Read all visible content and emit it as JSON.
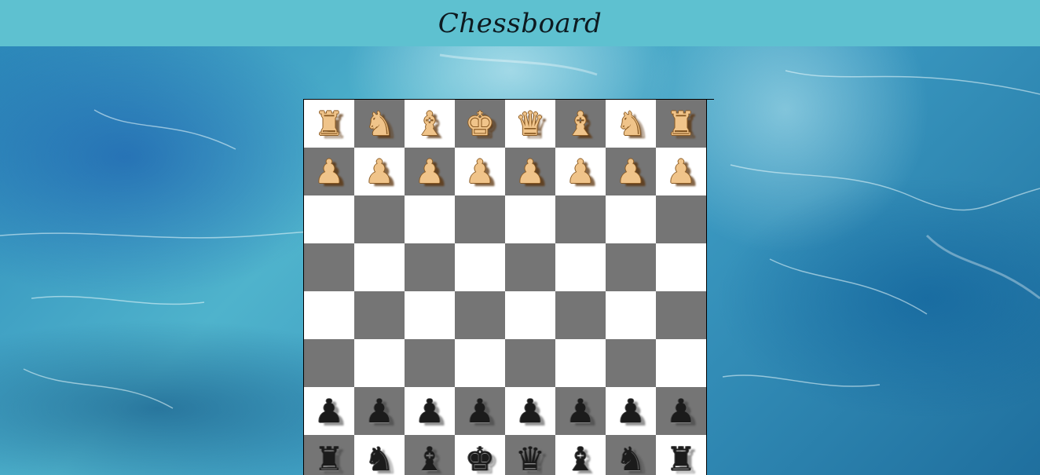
{
  "header": {
    "title": "Chessboard",
    "background": "#5ec1d0"
  },
  "board": {
    "light_color": "#ffffff",
    "dark_color": "#757575",
    "ranks": [
      [
        {
          "piece": "rook",
          "color": "white",
          "glyph": "♜"
        },
        {
          "piece": "knight",
          "color": "white",
          "glyph": "♞"
        },
        {
          "piece": "bishop",
          "color": "white",
          "glyph": "♝"
        },
        {
          "piece": "king",
          "color": "white",
          "glyph": "♚"
        },
        {
          "piece": "queen",
          "color": "white",
          "glyph": "♛"
        },
        {
          "piece": "bishop",
          "color": "white",
          "glyph": "♝"
        },
        {
          "piece": "knight",
          "color": "white",
          "glyph": "♞"
        },
        {
          "piece": "rook",
          "color": "white",
          "glyph": "♜"
        }
      ],
      [
        {
          "piece": "pawn",
          "color": "white",
          "glyph": "♟"
        },
        {
          "piece": "pawn",
          "color": "white",
          "glyph": "♟"
        },
        {
          "piece": "pawn",
          "color": "white",
          "glyph": "♟"
        },
        {
          "piece": "pawn",
          "color": "white",
          "glyph": "♟"
        },
        {
          "piece": "pawn",
          "color": "white",
          "glyph": "♟"
        },
        {
          "piece": "pawn",
          "color": "white",
          "glyph": "♟"
        },
        {
          "piece": "pawn",
          "color": "white",
          "glyph": "♟"
        },
        {
          "piece": "pawn",
          "color": "white",
          "glyph": "♟"
        }
      ],
      [
        null,
        null,
        null,
        null,
        null,
        null,
        null,
        null
      ],
      [
        null,
        null,
        null,
        null,
        null,
        null,
        null,
        null
      ],
      [
        null,
        null,
        null,
        null,
        null,
        null,
        null,
        null
      ],
      [
        null,
        null,
        null,
        null,
        null,
        null,
        null,
        null
      ],
      [
        {
          "piece": "pawn",
          "color": "black",
          "glyph": "♟"
        },
        {
          "piece": "pawn",
          "color": "black",
          "glyph": "♟"
        },
        {
          "piece": "pawn",
          "color": "black",
          "glyph": "♟"
        },
        {
          "piece": "pawn",
          "color": "black",
          "glyph": "♟"
        },
        {
          "piece": "pawn",
          "color": "black",
          "glyph": "♟"
        },
        {
          "piece": "pawn",
          "color": "black",
          "glyph": "♟"
        },
        {
          "piece": "pawn",
          "color": "black",
          "glyph": "♟"
        },
        {
          "piece": "pawn",
          "color": "black",
          "glyph": "♟"
        }
      ],
      [
        {
          "piece": "rook",
          "color": "black",
          "glyph": "♜"
        },
        {
          "piece": "knight",
          "color": "black",
          "glyph": "♞"
        },
        {
          "piece": "bishop",
          "color": "black",
          "glyph": "♝"
        },
        {
          "piece": "king",
          "color": "black",
          "glyph": "♚"
        },
        {
          "piece": "queen",
          "color": "black",
          "glyph": "♛"
        },
        {
          "piece": "bishop",
          "color": "black",
          "glyph": "♝"
        },
        {
          "piece": "knight",
          "color": "black",
          "glyph": "♞"
        },
        {
          "piece": "rook",
          "color": "black",
          "glyph": "♜"
        }
      ]
    ]
  }
}
